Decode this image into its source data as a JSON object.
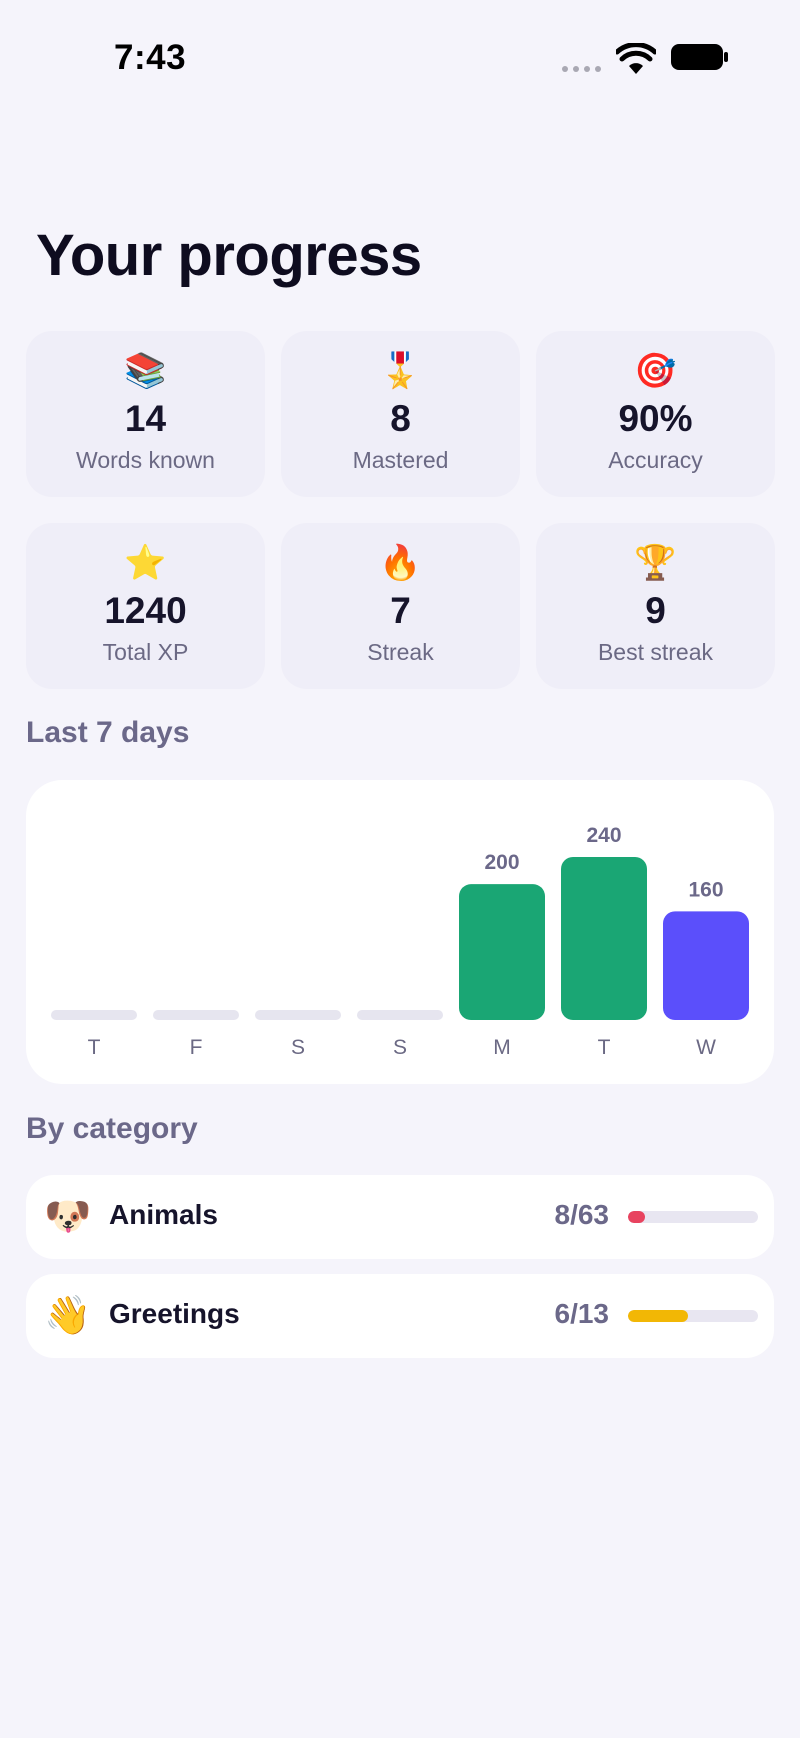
{
  "status_bar": {
    "time": "7:43"
  },
  "page_title": "Your progress",
  "stats": [
    {
      "icon": "📚",
      "icon_name": "books-icon",
      "value": "14",
      "label": "Words known"
    },
    {
      "icon": "🎖️",
      "icon_name": "medal-icon",
      "value": "8",
      "label": "Mastered"
    },
    {
      "icon": "🎯",
      "icon_name": "target-icon",
      "value": "90%",
      "label": "Accuracy"
    },
    {
      "icon": "⭐",
      "icon_name": "star-icon",
      "value": "1240",
      "label": "Total XP"
    },
    {
      "icon": "🔥",
      "icon_name": "fire-icon",
      "value": "7",
      "label": "Streak"
    },
    {
      "icon": "🏆",
      "icon_name": "trophy-icon",
      "value": "9",
      "label": "Best streak"
    }
  ],
  "sections": {
    "last7": "Last 7 days",
    "by_category": "By category"
  },
  "chart_data": {
    "type": "bar",
    "categories": [
      "T",
      "F",
      "S",
      "S",
      "M",
      "T",
      "W"
    ],
    "values": [
      0,
      0,
      0,
      0,
      200,
      240,
      160
    ],
    "data_labels": [
      "",
      "",
      "",
      "",
      "200",
      "240",
      "160"
    ],
    "ylim": [
      0,
      240
    ],
    "colors": [
      "#e6e5ef",
      "#e6e5ef",
      "#e6e5ef",
      "#e6e5ef",
      "#1aa674",
      "#1aa674",
      "#5b4ffb"
    ],
    "title": "",
    "xlabel": "",
    "ylabel": "",
    "grid": false
  },
  "categories": [
    {
      "icon": "🐶",
      "icon_name": "dog-icon",
      "name": "Animals",
      "count": "8/63",
      "progress": 0.127,
      "color": "#e8435f"
    },
    {
      "icon": "👋",
      "icon_name": "waving-hand-icon",
      "name": "Greetings",
      "count": "6/13",
      "progress": 0.46,
      "color": "#f2b705"
    }
  ]
}
